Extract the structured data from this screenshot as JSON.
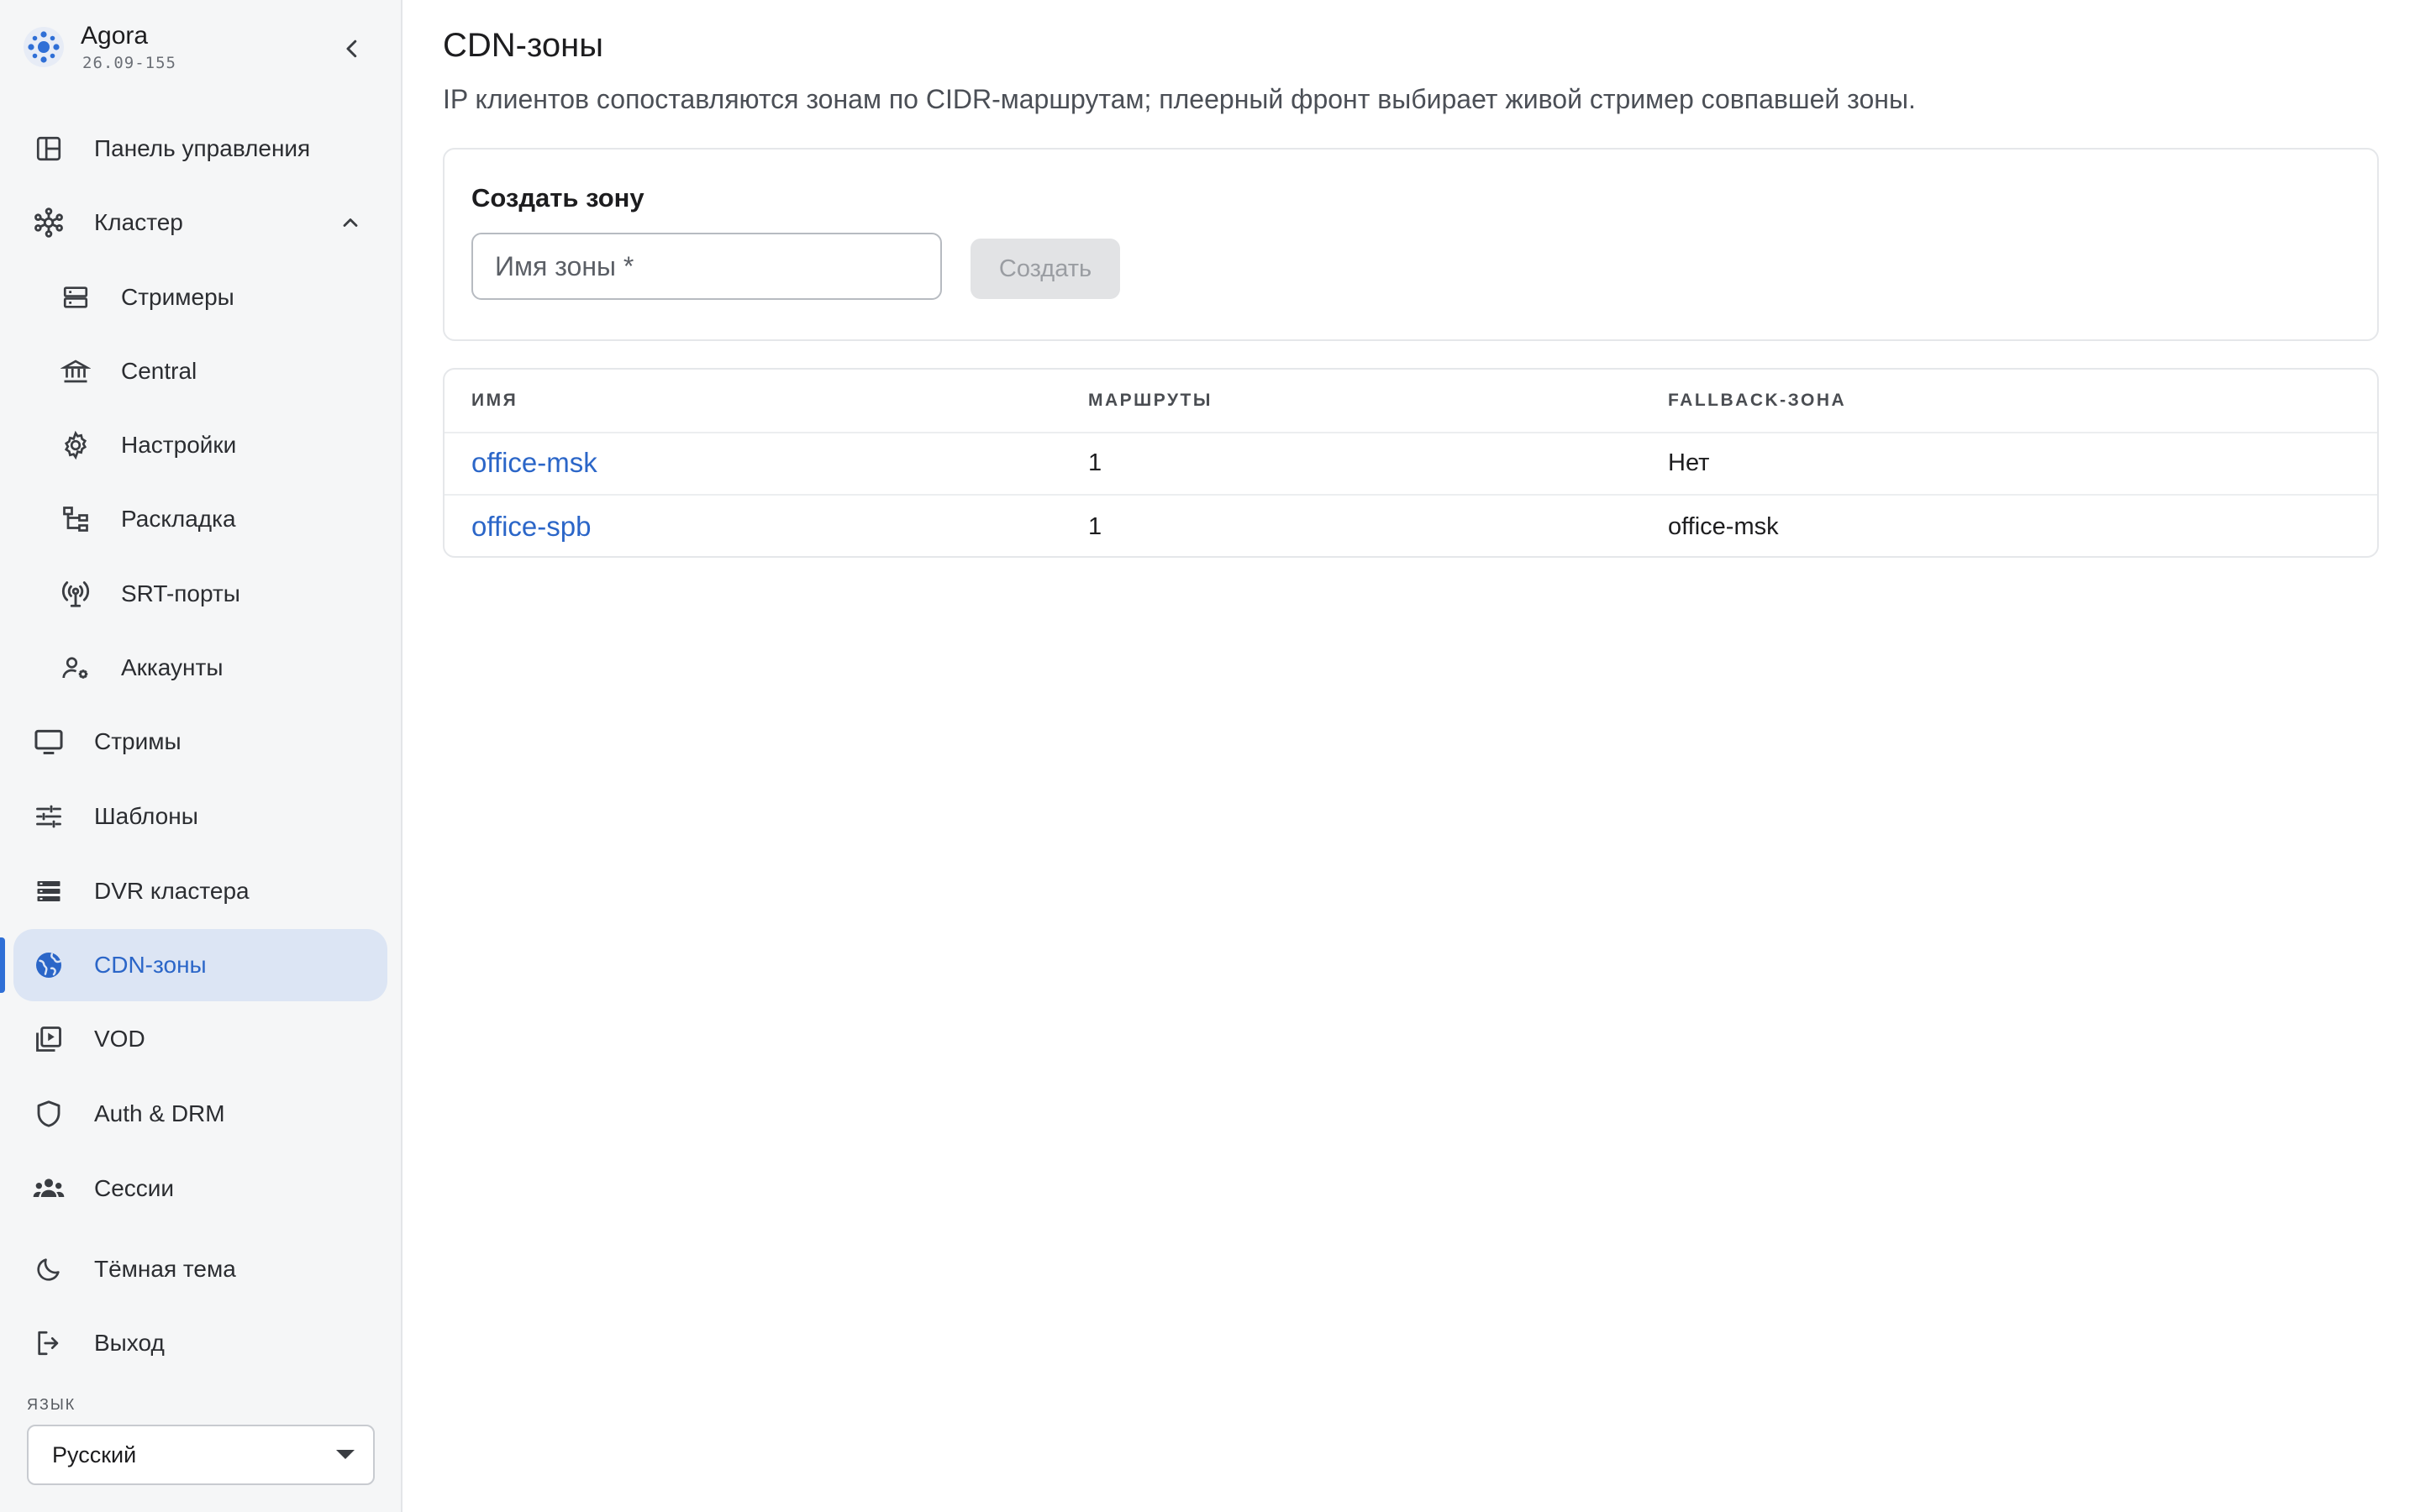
{
  "brand": {
    "name": "Agora",
    "version": "26.09-155"
  },
  "sidebar": {
    "items": [
      {
        "label": "Панель управления",
        "icon": "dashboard-icon"
      },
      {
        "label": "Кластер",
        "icon": "cluster-icon",
        "expanded": true
      },
      {
        "label": "Стримеры",
        "icon": "server-icon"
      },
      {
        "label": "Central",
        "icon": "bank-icon"
      },
      {
        "label": "Настройки",
        "icon": "gear-icon"
      },
      {
        "label": "Раскладка",
        "icon": "layout-tree-icon"
      },
      {
        "label": "SRT-порты",
        "icon": "antenna-icon"
      },
      {
        "label": "Аккаунты",
        "icon": "account-settings-icon"
      },
      {
        "label": "Стримы",
        "icon": "monitor-icon"
      },
      {
        "label": "Шаблоны",
        "icon": "sliders-icon"
      },
      {
        "label": "DVR кластера",
        "icon": "storage-icon"
      },
      {
        "label": "CDN-зоны",
        "icon": "globe-icon",
        "active": true
      },
      {
        "label": "VOD",
        "icon": "video-library-icon"
      },
      {
        "label": "Auth & DRM",
        "icon": "shield-icon"
      },
      {
        "label": "Сессии",
        "icon": "users-icon"
      }
    ],
    "theme_toggle": "Тёмная тема",
    "logout": "Выход",
    "language": {
      "caption": "ЯЗЫК",
      "value": "Русский"
    }
  },
  "page": {
    "title": "CDN-зоны",
    "subtitle": "IP клиентов сопоставляются зонам по CIDR-маршрутам; плеерный фронт выбирает живой стример совпавшей зоны."
  },
  "create": {
    "title": "Создать зону",
    "input_placeholder": "Имя зоны *",
    "button_label": "Создать"
  },
  "table": {
    "columns": [
      "ИМЯ",
      "МАРШРУТЫ",
      "FALLBACK-ЗОНА"
    ],
    "rows": [
      {
        "name": "office-msk",
        "routes": "1",
        "fallback": "Нет"
      },
      {
        "name": "office-spb",
        "routes": "1",
        "fallback": "office-msk"
      }
    ]
  },
  "colors": {
    "accent": "#2b66c8",
    "active_bg": "#dce5f4",
    "sidebar_bg": "#f5f6f7"
  }
}
